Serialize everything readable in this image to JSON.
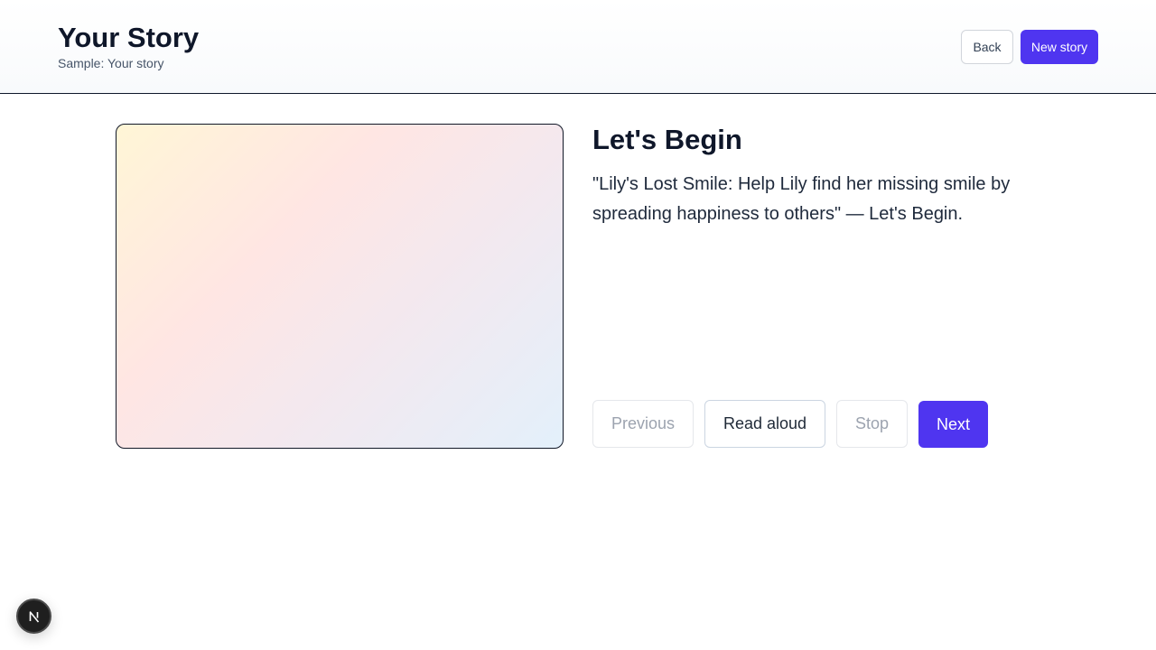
{
  "header": {
    "title": "Your Story",
    "subtitle": "Sample: Your story",
    "back_label": "Back",
    "new_story_label": "New story"
  },
  "page": {
    "heading": "Let's Begin",
    "text": "\"Lily's Lost Smile: Help Lily find her missing smile by spreading happiness to others\" — Let's Begin."
  },
  "controls": {
    "previous_label": "Previous",
    "read_aloud_label": "Read aloud",
    "stop_label": "Stop",
    "next_label": "Next"
  },
  "colors": {
    "accent": "#4f35f0",
    "title": "#0f172a",
    "disabled_text": "#9ca3af"
  },
  "icons": {
    "dev_badge": "nextjs-logo-icon"
  }
}
